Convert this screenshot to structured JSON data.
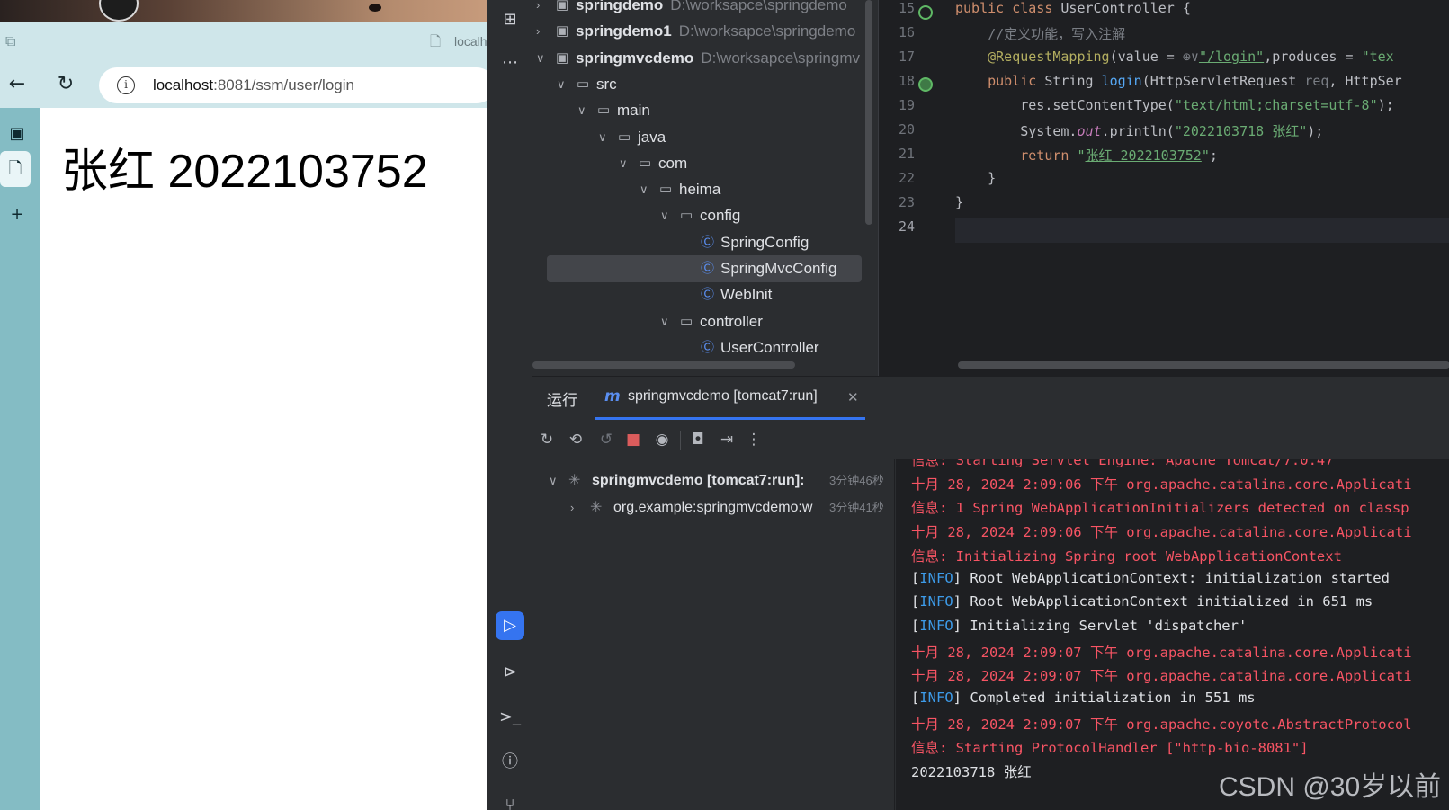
{
  "browser": {
    "tab_title": "localh",
    "url_host": "localhost",
    "url_rest": ":8081/ssm/user/login",
    "page_heading": "张红 2022103752"
  },
  "project_tree": [
    {
      "depth": 0,
      "chevron": "right",
      "icon": "module",
      "label": "springdemo",
      "path": "D:\\worksapce\\springdemo",
      "bold": true
    },
    {
      "depth": 0,
      "chevron": "right",
      "icon": "module",
      "label": "springdemo1",
      "path": "D:\\worksapce\\springdemo",
      "bold": true
    },
    {
      "depth": 0,
      "chevron": "down",
      "icon": "module",
      "label": "springmvcdemo",
      "path": "D:\\worksapce\\springmv",
      "bold": true
    },
    {
      "depth": 1,
      "chevron": "down",
      "icon": "folder",
      "label": "src",
      "path": "",
      "bold": false
    },
    {
      "depth": 2,
      "chevron": "down",
      "icon": "folder",
      "label": "main",
      "path": "",
      "bold": false
    },
    {
      "depth": 3,
      "chevron": "down",
      "icon": "folder-src",
      "label": "java",
      "path": "",
      "bold": false
    },
    {
      "depth": 4,
      "chevron": "down",
      "icon": "package",
      "label": "com",
      "path": "",
      "bold": false
    },
    {
      "depth": 5,
      "chevron": "down",
      "icon": "package",
      "label": "heima",
      "path": "",
      "bold": false
    },
    {
      "depth": 6,
      "chevron": "down",
      "icon": "package",
      "label": "config",
      "path": "",
      "bold": false
    },
    {
      "depth": 7,
      "chevron": "",
      "icon": "class",
      "label": "SpringConfig",
      "path": "",
      "bold": false
    },
    {
      "depth": 7,
      "chevron": "",
      "icon": "class",
      "label": "SpringMvcConfig",
      "path": "",
      "bold": false,
      "selected": true
    },
    {
      "depth": 7,
      "chevron": "",
      "icon": "class",
      "label": "WebInit",
      "path": "",
      "bold": false
    },
    {
      "depth": 6,
      "chevron": "down",
      "icon": "package",
      "label": "controller",
      "path": "",
      "bold": false
    },
    {
      "depth": 7,
      "chevron": "",
      "icon": "class",
      "label": "UserController",
      "path": "",
      "bold": false
    }
  ],
  "editor": {
    "line_numbers": [
      "15",
      "16",
      "17",
      "18",
      "19",
      "20",
      "21",
      "22",
      "23",
      "24"
    ],
    "lines": {
      "l15_kw": "public class ",
      "l15_rest": "UserController {",
      "l16": "    //定义功能，写入注解",
      "l17_an": "    @RequestMapping",
      "l17_a": "(value = ",
      "l17_globe": "⊕∨",
      "l17_str": "\"/login\"",
      "l17_b": ",produces = ",
      "l17_str2": "\"tex",
      "l18_kw": "    public ",
      "l18_type": "String ",
      "l18_fn": "login",
      "l18_a": "(HttpServletRequest ",
      "l18_par": "req",
      "l18_b": ", HttpSer",
      "l19_a": "        res.setContentType(",
      "l19_str": "\"text/html;charset=utf-8\"",
      "l19_b": ");",
      "l20_a": "        System.",
      "l20_fld": "out",
      "l20_b": ".println(",
      "l20_str": "\"2022103718 张红\"",
      "l20_c": ");",
      "l21_kw": "        return ",
      "l21_q1": "\"",
      "l21_str": "张红 2022103752",
      "l21_q2": "\"",
      "l21_end": ";",
      "l22": "    }",
      "l23": "}"
    }
  },
  "run_panel": {
    "title": "运行",
    "tab_label": "springmvcdemo [tomcat7:run]",
    "tree": [
      {
        "label": "springmvcdemo [tomcat7:run]:",
        "time": "3分钟46秒"
      },
      {
        "label": "org.example:springmvcdemo:w",
        "time": "3分钟41秒"
      }
    ],
    "console": [
      {
        "style": "red",
        "text": "信息: Starting Servlet Engine: Apache Tomcat/7.0.47"
      },
      {
        "style": "red",
        "text": "十月 28, 2024 2:09:06 下午 org.apache.catalina.core.Applicati"
      },
      {
        "style": "red",
        "text": "信息: 1 Spring WebApplicationInitializers detected on classp"
      },
      {
        "style": "red",
        "text": "十月 28, 2024 2:09:06 下午 org.apache.catalina.core.Applicati"
      },
      {
        "style": "red",
        "text": "信息: Initializing Spring root WebApplicationContext"
      },
      {
        "style": "info",
        "tag": "INFO",
        "text": " Root WebApplicationContext: initialization started"
      },
      {
        "style": "info",
        "tag": "INFO",
        "text": " Root WebApplicationContext initialized in 651 ms"
      },
      {
        "style": "info",
        "tag": "INFO",
        "text": " Initializing Servlet 'dispatcher'"
      },
      {
        "style": "red",
        "text": "十月 28, 2024 2:09:07 下午 org.apache.catalina.core.Applicati"
      },
      {
        "style": "red",
        "text": "十月 28, 2024 2:09:07 下午 org.apache.catalina.core.Applicati"
      },
      {
        "style": "info",
        "tag": "INFO",
        "text": " Completed initialization in 551 ms"
      },
      {
        "style": "red",
        "text": "十月 28, 2024 2:09:07 下午 org.apache.coyote.AbstractProtocol"
      },
      {
        "style": "red",
        "text": "信息: Starting ProtocolHandler [\"http-bio-8081\"]"
      },
      {
        "style": "plain",
        "text": "2022103718 张红"
      }
    ]
  },
  "watermark": "CSDN @30岁以前",
  "colors": {
    "accent": "#3574f0",
    "console_red": "#f75464",
    "info_blue": "#3d9be9",
    "browser_chrome": "#cfe6ea",
    "browser_sidebar": "#84bcc4"
  }
}
